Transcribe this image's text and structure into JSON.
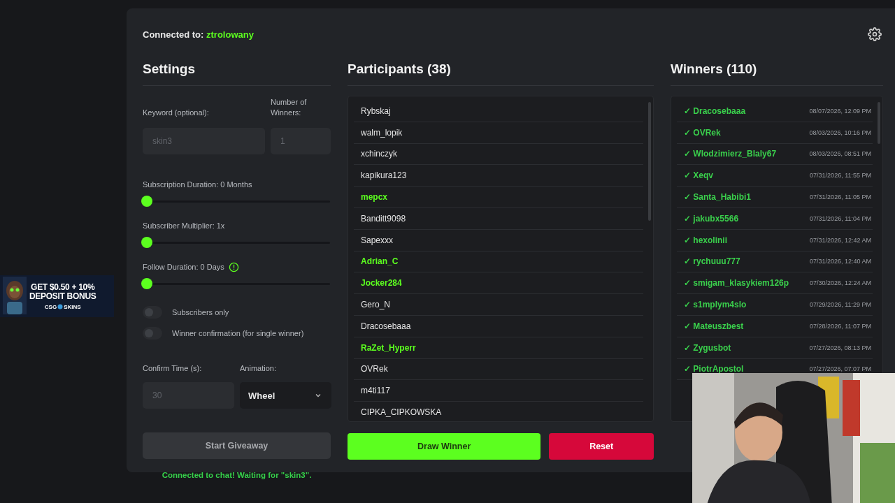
{
  "header": {
    "connected_label": "Connected to:",
    "channel": "ztrolowany"
  },
  "settings": {
    "title": "Settings",
    "keyword": {
      "label": "Keyword (optional):",
      "placeholder": "skin3"
    },
    "winners_count": {
      "label": "Number of Winners:",
      "placeholder": "1"
    },
    "sliders": [
      {
        "label": "Subscription Duration: 0 Months",
        "level": 0,
        "info": false
      },
      {
        "label": "Subscriber Multiplier: 1x",
        "level": 0,
        "info": false
      },
      {
        "label": "Follow Duration:  0  Days",
        "level": 0,
        "info": true
      }
    ],
    "toggles": [
      {
        "label": "Subscribers only",
        "on": false
      },
      {
        "label": "Winner confirmation (for single winner)",
        "on": false
      }
    ],
    "confirm_time": {
      "label": "Confirm Time (s):",
      "placeholder": "30"
    },
    "animation": {
      "label": "Animation:",
      "value": "Wheel"
    },
    "start_button": "Start Giveaway",
    "status": "Connected to chat! Waiting for \"skin3\"."
  },
  "participants": {
    "title": "Participants (38)",
    "items": [
      {
        "name": "Rybskaj",
        "highlighted": false
      },
      {
        "name": "walm_lopik",
        "highlighted": false
      },
      {
        "name": "xchinczyk",
        "highlighted": false
      },
      {
        "name": "kapikura123",
        "highlighted": false
      },
      {
        "name": "mepcx",
        "highlighted": true
      },
      {
        "name": "Banditt9098",
        "highlighted": false
      },
      {
        "name": "Sapexxx",
        "highlighted": false
      },
      {
        "name": "Adrian_C",
        "highlighted": true
      },
      {
        "name": "Jocker284",
        "highlighted": true
      },
      {
        "name": "Gero_N",
        "highlighted": false
      },
      {
        "name": "Dracosebaaa",
        "highlighted": false
      },
      {
        "name": "RaZet_Hyperr",
        "highlighted": true
      },
      {
        "name": "OVRek",
        "highlighted": false
      },
      {
        "name": "m4ti117",
        "highlighted": false
      },
      {
        "name": "CIPKA_CIPKOWSKA",
        "highlighted": false
      }
    ],
    "draw_button": "Draw Winner",
    "reset_button": "Reset"
  },
  "winners": {
    "title": "Winners (110)",
    "items": [
      {
        "mark": "✓",
        "name": "Dracosebaaa",
        "time": "08/07/2026, 12:09 PM"
      },
      {
        "mark": "✓",
        "name": "OVRek",
        "time": "08/03/2026, 10:16 PM"
      },
      {
        "mark": "✓",
        "name": "Wlodzimierz_Blaly67",
        "time": "08/03/2026, 08:51 PM"
      },
      {
        "mark": "✓",
        "name": "Xeqv",
        "time": "07/31/2026, 11:55 PM"
      },
      {
        "mark": "✓",
        "name": "Santa_Habibi1",
        "time": "07/31/2026, 11:05 PM"
      },
      {
        "mark": "✓",
        "name": "jakubx5566",
        "time": "07/31/2026, 11:04 PM"
      },
      {
        "mark": "✓",
        "name": "hexolinii",
        "time": "07/31/2026, 12:42 AM"
      },
      {
        "mark": "✓",
        "name": "rychuuu777",
        "time": "07/31/2026, 12:40 AM"
      },
      {
        "mark": "✓",
        "name": "smigam_klasykiem126p",
        "time": "07/30/2026, 12:24 AM"
      },
      {
        "mark": "✓",
        "name": "s1mplym4slo",
        "time": "07/29/2026, 11:29 PM"
      },
      {
        "mark": "✓",
        "name": "Mateuszbest",
        "time": "07/28/2026, 11:07 PM"
      },
      {
        "mark": "✓",
        "name": "Zygusbot",
        "time": "07/27/2026, 08:13 PM"
      },
      {
        "mark": "✓",
        "name": "PiotrApostol",
        "time": "07/27/2026, 07:07 PM"
      }
    ]
  },
  "ad": {
    "line_1": "GET $0.50 + 10%",
    "line_2": "DEPOSIT BONUS",
    "logo_left": "CSG",
    "logo_right": "SKINS"
  }
}
